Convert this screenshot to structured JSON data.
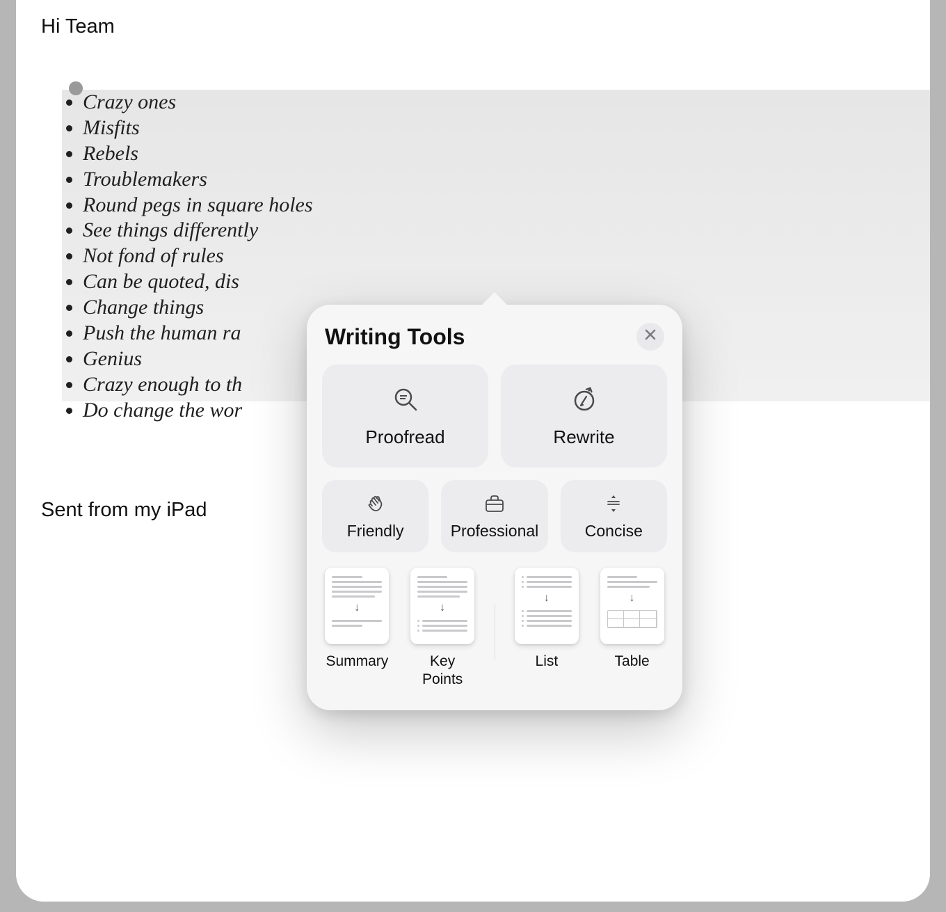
{
  "email": {
    "greeting": "Hi Team",
    "bullets": [
      "Crazy ones",
      "Misfits",
      "Rebels",
      "Troublemakers",
      "Round pegs in square holes",
      "See things differently",
      "Not fond of rules",
      "Can be quoted, dis",
      "Change things",
      "Push the human ra",
      "Genius",
      "Crazy enough to th",
      "Do change the wor"
    ],
    "signature": "Sent from my iPad"
  },
  "popover": {
    "title": "Writing Tools",
    "close_icon": "✕",
    "primary": [
      {
        "label": "Proofread"
      },
      {
        "label": "Rewrite"
      }
    ],
    "tones": [
      {
        "label": "Friendly"
      },
      {
        "label": "Professional"
      },
      {
        "label": "Concise"
      }
    ],
    "transforms": [
      {
        "label": "Summary"
      },
      {
        "label": "Key Points"
      },
      {
        "label": "List"
      },
      {
        "label": "Table"
      }
    ]
  }
}
